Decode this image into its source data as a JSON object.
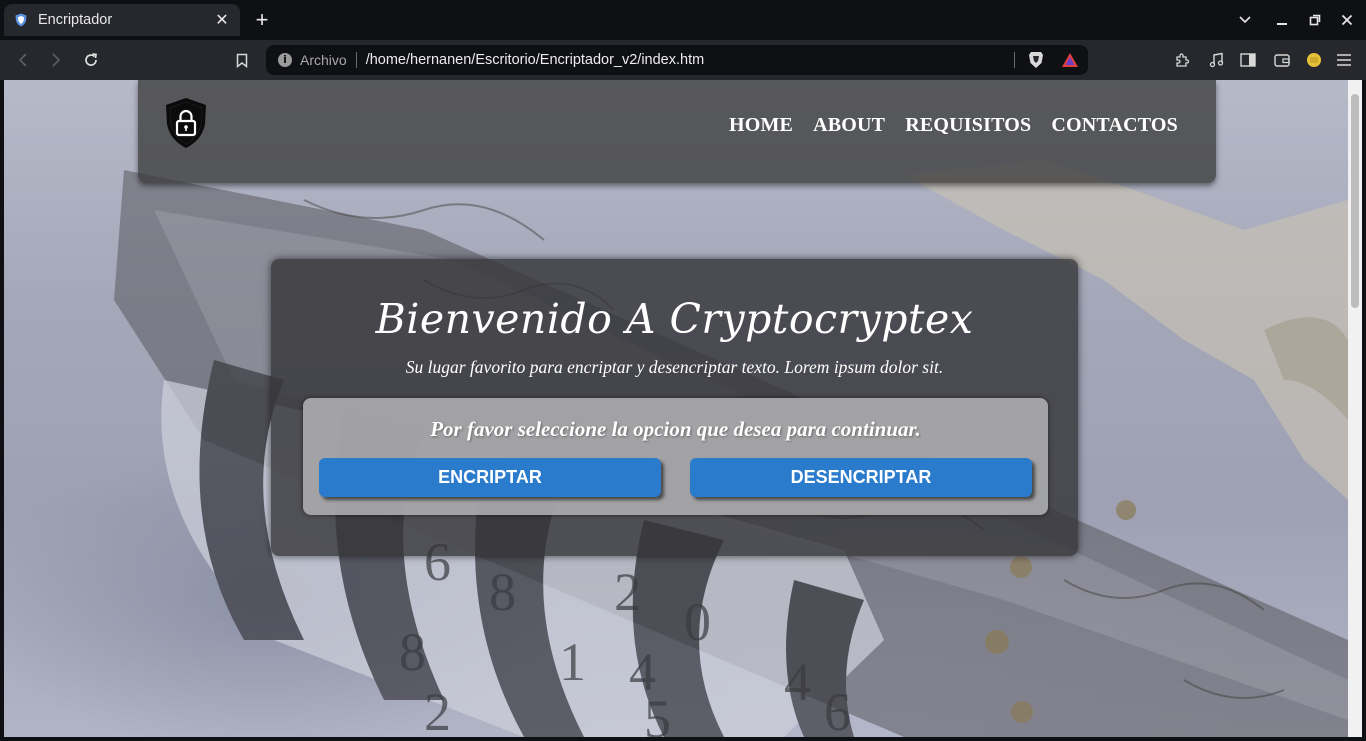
{
  "browser": {
    "tab": {
      "title": "Encriptador",
      "favicon": "shield-icon"
    },
    "address": {
      "security_label": "Archivo",
      "url": "/home/hernanen/Escritorio/Encriptador_v2/index.htm"
    },
    "icons": [
      "back-icon",
      "forward-icon",
      "reload-icon",
      "bookmark-icon",
      "brave-shield-icon",
      "brave-rewards-icon",
      "extensions-icon",
      "media-icon",
      "sidebar-icon",
      "wallet-icon",
      "coin-icon",
      "menu-icon"
    ],
    "colors": {
      "frame": "#0f1014",
      "toolbar": "#26282d"
    }
  },
  "page": {
    "nav": {
      "home": "HOME",
      "about": "ABOUT",
      "requisitos": "REQUISITOS",
      "contactos": "CONTACTOS"
    },
    "hero": {
      "title": "Bienvenido A Cryptocryptex",
      "subtitle": "Su lugar favorito para encriptar y desencriptar texto. Lorem ipsum dolor sit.",
      "prompt": "Por favor seleccione la opcion que desea para continuar.",
      "encrypt_label": "ENCRIPTAR",
      "decrypt_label": "DESENCRIPTAR"
    },
    "colors": {
      "button": "#2a7bcc",
      "header": "#3c3c3c"
    }
  }
}
